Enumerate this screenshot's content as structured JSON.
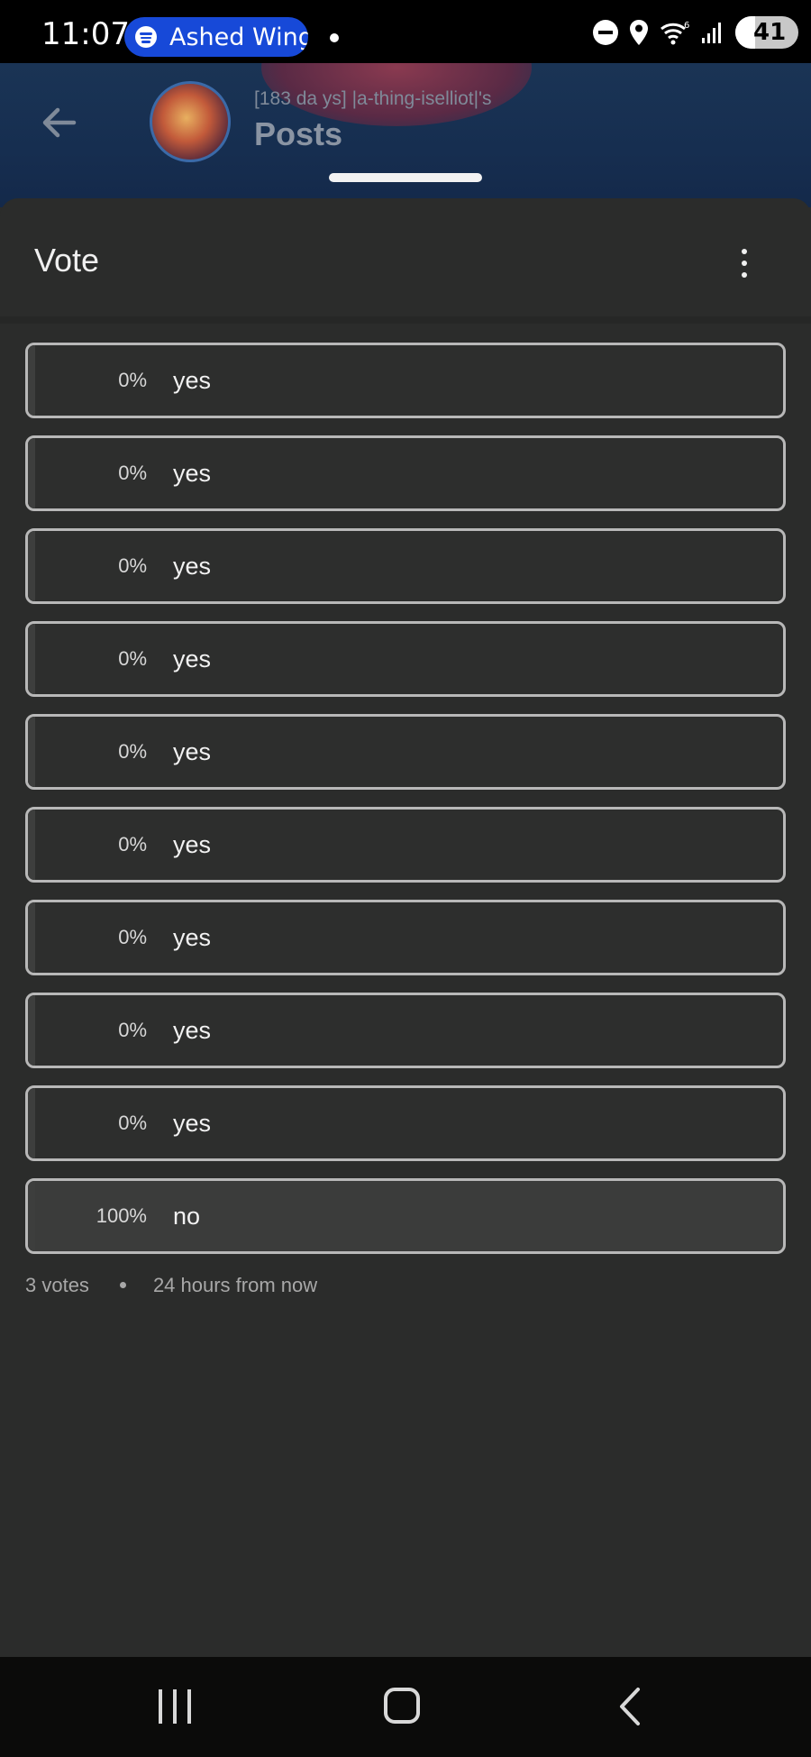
{
  "status_bar": {
    "time": "11:07",
    "media_pill_text": "Ashed Wing",
    "battery": "41"
  },
  "header": {
    "subtitle": "[183 da ys] |a-thing-iselliot|'s",
    "title": "Posts"
  },
  "sheet": {
    "title": "Vote"
  },
  "poll": {
    "options": [
      {
        "percent": "0%",
        "label": "yes",
        "fraction": 0
      },
      {
        "percent": "0%",
        "label": "yes",
        "fraction": 0
      },
      {
        "percent": "0%",
        "label": "yes",
        "fraction": 0
      },
      {
        "percent": "0%",
        "label": "yes",
        "fraction": 0
      },
      {
        "percent": "0%",
        "label": "yes",
        "fraction": 0
      },
      {
        "percent": "0%",
        "label": "yes",
        "fraction": 0
      },
      {
        "percent": "0%",
        "label": "yes",
        "fraction": 0
      },
      {
        "percent": "0%",
        "label": "yes",
        "fraction": 0
      },
      {
        "percent": "0%",
        "label": "yes",
        "fraction": 0
      },
      {
        "percent": "100%",
        "label": "no",
        "fraction": 1
      }
    ],
    "votes": "3 votes",
    "ends": "24 hours from now"
  },
  "colors": {
    "background": "#2b2c2b",
    "option_border": "#b8b8b8",
    "media_pill": "#1749d8"
  }
}
